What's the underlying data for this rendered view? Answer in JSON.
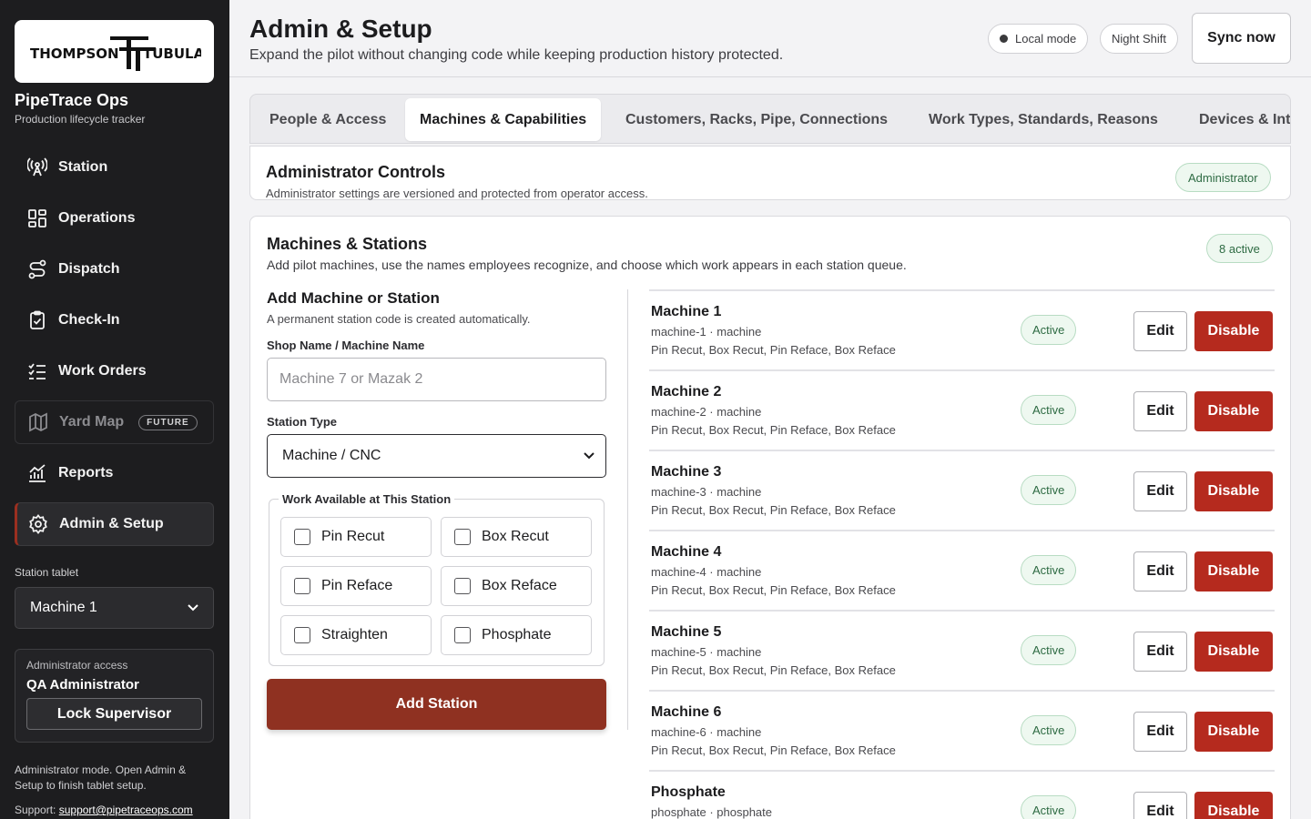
{
  "brand": {
    "logo_left": "THOMPSON",
    "logo_right": "TUBULAR",
    "app_name": "PipeTrace Ops",
    "app_subtitle": "Production lifecycle tracker"
  },
  "nav": [
    {
      "label": "Station",
      "icon": "antenna-icon"
    },
    {
      "label": "Operations",
      "icon": "grid-icon"
    },
    {
      "label": "Dispatch",
      "icon": "route-icon"
    },
    {
      "label": "Check-In",
      "icon": "clipboard-check-icon"
    },
    {
      "label": "Work Orders",
      "icon": "checklist-icon"
    },
    {
      "label": "Yard Map",
      "icon": "map-icon",
      "badge": "FUTURE"
    },
    {
      "label": "Reports",
      "icon": "chart-icon"
    },
    {
      "label": "Admin & Setup",
      "icon": "gear-icon"
    }
  ],
  "station": {
    "label": "Station tablet",
    "value": "Machine 1"
  },
  "admin_access": {
    "label": "Administrator access",
    "name": "QA Administrator",
    "lock_label": "Lock Supervisor"
  },
  "admin_note": "Administrator mode. Open Admin & Setup to finish tablet setup.",
  "support": {
    "label": "Support:",
    "email": "support@pipetraceops.com"
  },
  "header": {
    "title": "Admin & Setup",
    "subtitle": "Expand the pilot without changing code while keeping production history protected.",
    "mode_pill": "Local mode",
    "shift_pill": "Night Shift",
    "sync_label": "Sync now"
  },
  "tabs": [
    "People & Access",
    "Machines & Capabilities",
    "Customers, Racks, Pipe, Connections",
    "Work Types, Standards, Reasons",
    "Devices & Int"
  ],
  "controls": {
    "title": "Administrator Controls",
    "subtitle": "Administrator settings are versioned and protected from operator access.",
    "badge": "Administrator"
  },
  "machines": {
    "title": "Machines & Stations",
    "subtitle": "Add pilot machines, use the names employees recognize, and choose which work appears in each station queue.",
    "badge": "8 active",
    "form": {
      "title": "Add Machine or Station",
      "subtitle": "A permanent station code is created automatically.",
      "name_label": "Shop Name / Machine Name",
      "name_placeholder": "Machine 7 or Mazak 2",
      "type_label": "Station Type",
      "type_value": "Machine / CNC",
      "work_legend": "Work Available at This Station",
      "work_options": [
        "Pin Recut",
        "Box Recut",
        "Pin Reface",
        "Box Reface",
        "Straighten",
        "Phosphate"
      ],
      "add_label": "Add Station"
    },
    "edit_label": "Edit",
    "disable_label": "Disable",
    "items": [
      {
        "name": "Machine 1",
        "code": "machine-1 · machine",
        "caps": "Pin Recut, Box Recut, Pin Reface, Box Reface",
        "status": "Active"
      },
      {
        "name": "Machine 2",
        "code": "machine-2 · machine",
        "caps": "Pin Recut, Box Recut, Pin Reface, Box Reface",
        "status": "Active"
      },
      {
        "name": "Machine 3",
        "code": "machine-3 · machine",
        "caps": "Pin Recut, Box Recut, Pin Reface, Box Reface",
        "status": "Active"
      },
      {
        "name": "Machine 4",
        "code": "machine-4 · machine",
        "caps": "Pin Recut, Box Recut, Pin Reface, Box Reface",
        "status": "Active"
      },
      {
        "name": "Machine 5",
        "code": "machine-5 · machine",
        "caps": "Pin Recut, Box Recut, Pin Reface, Box Reface",
        "status": "Active"
      },
      {
        "name": "Machine 6",
        "code": "machine-6 · machine",
        "caps": "Pin Recut, Box Recut, Pin Reface, Box Reface",
        "status": "Active"
      },
      {
        "name": "Phosphate",
        "code": "phosphate · phosphate",
        "caps": "",
        "status": "Active"
      }
    ]
  },
  "colors": {
    "sidebar": "#1d1d1f",
    "accent": "#8f3121",
    "danger": "#b52a1e",
    "success_bg": "#eef8f0",
    "success_text": "#2e6b43"
  }
}
